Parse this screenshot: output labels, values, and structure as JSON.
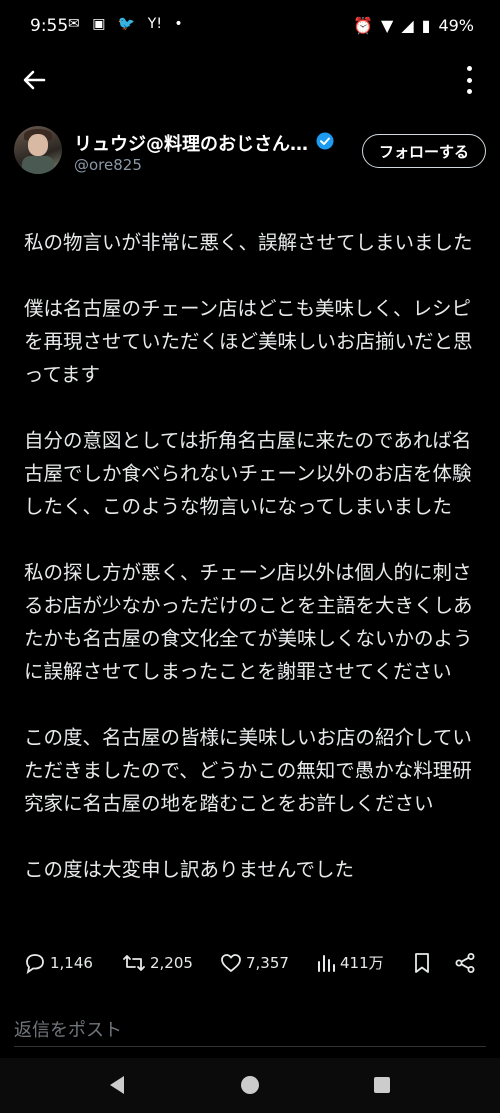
{
  "status_bar": {
    "time": "9:55",
    "battery": "49%",
    "yahoo_label": "Y!"
  },
  "header": {
    "back_icon": "arrow-left-icon",
    "more_icon": "more-vertical-icon"
  },
  "profile": {
    "display_name": "リュウジ@料理のおじさん…",
    "handle": "@ore825",
    "follow_label": "フォローする",
    "verified_color": "#1d9bf0"
  },
  "post": {
    "paragraphs": [
      "私の物言いが非常に悪く、誤解させてしまいました",
      "僕は名古屋のチェーン店はどこも美味しく、レシピを再現させていただくほど美味しいお店揃いだと思ってます",
      "自分の意図としては折角名古屋に来たのであれば名古屋でしか食べられないチェーン以外のお店を体験したく、このような物言いになってしまいました",
      "私の探し方が悪く、チェーン店以外は個人的に刺さるお店が少なかっただけのことを主語を大きくしあたかも名古屋の食文化全てが美味しくないかのように誤解させてしまったことを謝罪させてください",
      "この度、名古屋の皆様に美味しいお店の紹介していただきましたので、どうかこの無知で愚かな料理研究家に名古屋の地を踏むことをお許しください",
      "この度は大変申し訳ありませんでした"
    ]
  },
  "actions": {
    "replies": "1,146",
    "reposts": "2,205",
    "likes": "7,357",
    "views": "411万"
  },
  "reply": {
    "placeholder": "返信をポスト"
  }
}
